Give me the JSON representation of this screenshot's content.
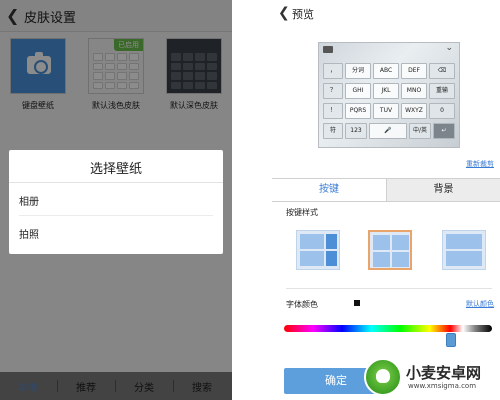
{
  "left": {
    "header": {
      "back_icon": "chevron-left-icon",
      "title": "皮肤设置"
    },
    "skins": [
      {
        "label": "键盘壁纸",
        "icon": "camera-icon"
      },
      {
        "label": "默认浅色皮肤",
        "badge": "已启用"
      },
      {
        "label": "默认深色皮肤"
      }
    ],
    "dialog": {
      "title": "选择壁纸",
      "options": [
        "相册",
        "拍照"
      ]
    },
    "bottom_tabs": [
      "本地",
      "推荐",
      "分类",
      "搜索"
    ]
  },
  "right": {
    "header": {
      "back_icon": "chevron-left-icon",
      "title": "预览"
    },
    "keyboard": {
      "rows": [
        [
          "，",
          "分词",
          "ABC",
          "DEF",
          "⌫"
        ],
        [
          "？",
          "GHI",
          "JKL",
          "MNO",
          "重输"
        ],
        [
          "！",
          "PQRS",
          "TUV",
          "WXYZ",
          "0"
        ],
        [
          "符",
          "123",
          "🎤",
          "中/英",
          "↵"
        ]
      ]
    },
    "reset_link": "重新裁剪",
    "tabs": [
      "按键",
      "背景"
    ],
    "active_tab": "按键",
    "style_label": "按键样式",
    "layout_options": [
      "layout-1",
      "layout-2",
      "layout-3"
    ],
    "selected_layout": 1,
    "font_color_label": "字体颜色",
    "font_color": "#000000",
    "default_color_link": "默认颜色",
    "confirm_label": "确定"
  },
  "watermark": {
    "text": "小麦安卓网",
    "url": "www.xmsigma.com"
  },
  "colors": {
    "accent": "#3a7bd5",
    "badge": "#6abf4b",
    "button": "#5d9fdd"
  }
}
